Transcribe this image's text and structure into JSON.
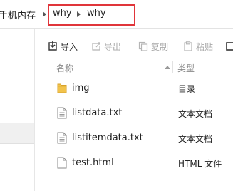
{
  "breadcrumb": {
    "items": [
      {
        "label": "手机内存"
      },
      {
        "label": "why"
      },
      {
        "label": "why"
      }
    ]
  },
  "toolbar": {
    "import_label": "导入",
    "export_label": "导出",
    "copy_label": "复制",
    "paste_label": "粘贴"
  },
  "columns": {
    "name_label": "名称",
    "type_label": "类型"
  },
  "files": [
    {
      "name": "img",
      "type": "目录",
      "icon": "folder-icon"
    },
    {
      "name": "listdata.txt",
      "type": "文本文档",
      "icon": "text-file-icon"
    },
    {
      "name": "listitemdata.txt",
      "type": "文本文档",
      "icon": "text-file-icon"
    },
    {
      "name": "test.html",
      "type": "HTML 文件",
      "icon": "html-file-icon"
    }
  ],
  "colors": {
    "highlight": "#e0353a",
    "folder": "#f2c34b",
    "disabled_text": "#a8a8a8"
  }
}
